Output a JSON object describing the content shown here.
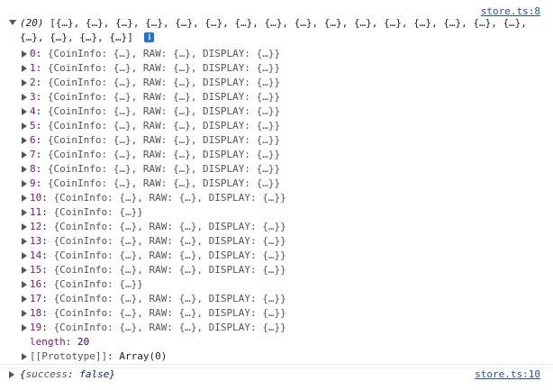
{
  "messages": [
    {
      "source": "store.ts:8",
      "count_label": "(20)",
      "preview": "[{…}, {…}, {…}, {…}, {…}, {…}, {…}, {…}, {…}, {…}, {…}, {…}, {…}, {…}, {…}, {…}, {…}, {…}, {…}, {…}]",
      "info_badge": "i",
      "items": [
        {
          "index": "0",
          "content": "{CoinInfo: {…}, RAW: {…}, DISPLAY: {…}}"
        },
        {
          "index": "1",
          "content": "{CoinInfo: {…}, RAW: {…}, DISPLAY: {…}}"
        },
        {
          "index": "2",
          "content": "{CoinInfo: {…}, RAW: {…}, DISPLAY: {…}}"
        },
        {
          "index": "3",
          "content": "{CoinInfo: {…}, RAW: {…}, DISPLAY: {…}}"
        },
        {
          "index": "4",
          "content": "{CoinInfo: {…}, RAW: {…}, DISPLAY: {…}}"
        },
        {
          "index": "5",
          "content": "{CoinInfo: {…}, RAW: {…}, DISPLAY: {…}}"
        },
        {
          "index": "6",
          "content": "{CoinInfo: {…}, RAW: {…}, DISPLAY: {…}}"
        },
        {
          "index": "7",
          "content": "{CoinInfo: {…}, RAW: {…}, DISPLAY: {…}}"
        },
        {
          "index": "8",
          "content": "{CoinInfo: {…}, RAW: {…}, DISPLAY: {…}}"
        },
        {
          "index": "9",
          "content": "{CoinInfo: {…}, RAW: {…}, DISPLAY: {…}}"
        },
        {
          "index": "10",
          "content": "{CoinInfo: {…}, RAW: {…}, DISPLAY: {…}}"
        },
        {
          "index": "11",
          "content": "{CoinInfo: {…}}"
        },
        {
          "index": "12",
          "content": "{CoinInfo: {…}, RAW: {…}, DISPLAY: {…}}"
        },
        {
          "index": "13",
          "content": "{CoinInfo: {…}, RAW: {…}, DISPLAY: {…}}"
        },
        {
          "index": "14",
          "content": "{CoinInfo: {…}, RAW: {…}, DISPLAY: {…}}"
        },
        {
          "index": "15",
          "content": "{CoinInfo: {…}, RAW: {…}, DISPLAY: {…}}"
        },
        {
          "index": "16",
          "content": "{CoinInfo: {…}}"
        },
        {
          "index": "17",
          "content": "{CoinInfo: {…}, RAW: {…}, DISPLAY: {…}}"
        },
        {
          "index": "18",
          "content": "{CoinInfo: {…}, RAW: {…}, DISPLAY: {…}}"
        },
        {
          "index": "19",
          "content": "{CoinInfo: {…}, RAW: {…}, DISPLAY: {…}}"
        }
      ],
      "length_key": "length",
      "length_value": "20",
      "prototype_key": "[[Prototype]]",
      "prototype_value": "Array(0)"
    },
    {
      "source": "store.ts:10",
      "object_open": "{",
      "object_key": "success",
      "object_sep": ": ",
      "object_value": "false",
      "object_close": "}"
    }
  ],
  "colors": {
    "link": "#1a55c4",
    "key": "#881280",
    "number": "#1c00cf",
    "boolean": "#0d22aa",
    "info_badge": "#1a73e8"
  },
  "icons": [
    "expand-triangle-down-icon",
    "expand-triangle-right-icon",
    "info-icon"
  ]
}
